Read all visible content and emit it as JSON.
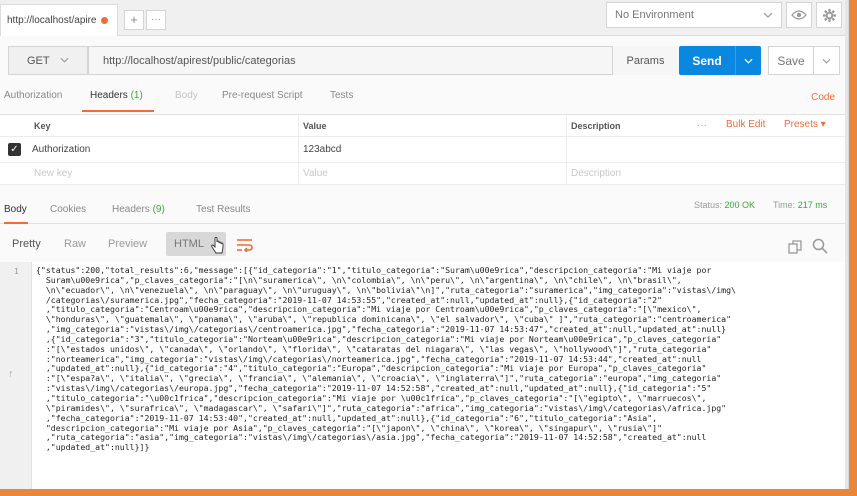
{
  "tabbar": {
    "tab_title": "http://localhost/apires",
    "add_label": "+",
    "more_label": "···",
    "environment": "No Environment"
  },
  "request": {
    "method": "GET",
    "url": "http://localhost/apirest/public/categorias",
    "params_label": "Params",
    "send_label": "Send",
    "save_label": "Save"
  },
  "request_tabs": {
    "authorization": "Authorization",
    "headers": "Headers",
    "headers_count": "(1)",
    "body": "Body",
    "pre_request": "Pre-request Script",
    "tests": "Tests",
    "code": "Code"
  },
  "headers_table": {
    "col_key": "Key",
    "col_value": "Value",
    "col_description": "Description",
    "more": "···",
    "bulk_edit": "Bulk Edit",
    "presets": "Presets ▾",
    "row_key": "Authorization",
    "row_value": "123abcd",
    "new_key_placeholder": "New key",
    "value_placeholder": "Value",
    "description_placeholder": "Description"
  },
  "response_tabs": {
    "body": "Body",
    "cookies": "Cookies",
    "headers": "Headers",
    "headers_count": "(9)",
    "test_results": "Test Results",
    "status_label": "Status:",
    "status_value": "200 OK",
    "time_label": "Time:",
    "time_value": "217 ms"
  },
  "response_toolbar": {
    "pretty": "Pretty",
    "raw": "Raw",
    "preview": "Preview",
    "html": "HTML"
  },
  "response_body": {
    "line_number": "1",
    "fold_marker": "f",
    "code": "{\"status\":200,\"total_results\":6,\"message\":[{\"id_categoria\":\"1\",\"titulo_categoria\":\"Suram\\u00e9rica\",\"descripcion_categoria\":\"Mi viaje por\n  Suram\\u00e9rica\",\"p_claves_categoria\":\"[\\n\\\"suramerica\\\", \\n\\\"colombia\\\", \\n\\\"peru\\\", \\n\\\"argentina\\\", \\n\\\"chile\\\", \\n\\\"brasil\\\",\n  \\n\\\"ecuador\\\", \\n\\\"venezuela\\\", \\n\\\"paraguay\\\", \\n\\\"uruguay\\\", \\n\\\"bolivia\\\"\\n]\",\"ruta_categoria\":\"suramerica\",\"img_categoria\":\"vistas\\/img\\\n  /categorias\\/suramerica.jpg\",\"fecha_categoria\":\"2019-11-07 14:53:55\",\"created_at\":null,\"updated_at\":null},{\"id_categoria\":\"2\"\n  ,\"titulo_categoria\":\"Centroam\\u00e9rica\",\"descripcion_categoria\":\"Mi viaje por Centroam\\u00e9rica\",\"p_claves_categoria\":\"[\\\"mexico\\\",\n  \\\"honduras\\\", \\\"guatemala\\\", \\\"panama\\\", \\\"aruba\\\", \\\"republica dominicana\\\", \\\"el salvador\\\", \\\"cuba\\\" ]\",\"ruta_categoria\":\"centroamerica\"\n  ,\"img_categoria\":\"vistas\\/img\\/categorias\\/centroamerica.jpg\",\"fecha_categoria\":\"2019-11-07 14:53:47\",\"created_at\":null,\"updated_at\":null}\n  ,{\"id_categoria\":\"3\",\"titulo_categoria\":\"Norteam\\u00e9rica\",\"descripcion_categoria\":\"Mi viaje por Norteam\\u00e9rica\",\"p_claves_categoria\"\n  :\"[\\\"estados unidos\\\", \\\"canada\\\", \\\"orlando\\\", \\\"florida\\\", \\\"cataratas del niagara\\\", \\\"las vegas\\\", \\\"hollywood\\\"]\",\"ruta_categoria\"\n  :\"norteamerica\",\"img_categoria\":\"vistas\\/img\\/categorias\\/norteamerica.jpg\",\"fecha_categoria\":\"2019-11-07 14:53:44\",\"created_at\":null\n  ,\"updated_at\":null},{\"id_categoria\":\"4\",\"titulo_categoria\":\"Europa\",\"descripcion_categoria\":\"Mi viaje por Europa\",\"p_claves_categoria\"\n  :\"[\\\"espa?a\\\", \\\"italia\\\", \\\"grecia\\\", \\\"francia\\\", \\\"alemania\\\", \\\"croacia\\\", \\\"inglaterra\\\"]\",\"ruta_categoria\":\"europa\",\"img_categoria\"\n  :\"vistas\\/img\\/categorias\\/europa.jpg\",\"fecha_categoria\":\"2019-11-07 14:52:58\",\"created_at\":null,\"updated_at\":null},{\"id_categoria\":\"5\"\n  ,\"titulo_categoria\":\"\\u00c1frica\",\"descripcion_categoria\":\"Mi viaje por \\u00c1frica\",\"p_claves_categoria\":\"[\\\"egipto\\\", \\\"marruecos\\\",\n  \\\"piramides\\\", \\\"surafrica\\\", \\\"madagascar\\\", \\\"safari\\\"]\",\"ruta_categoria\":\"africa\",\"img_categoria\":\"vistas\\/img\\/categorias\\/africa.jpg\"\n  ,\"fecha_categoria\":\"2019-11-07 14:53:40\",\"created_at\":null,\"updated_at\":null},{\"id_categoria\":\"6\",\"titulo_categoria\":\"Asia\",\n  \"descripcion_categoria\":\"Mi viaje por Asia\",\"p_claves_categoria\":\"[\\\"japon\\\", \\\"china\\\", \\\"korea\\\", \\\"singapur\\\", \\\"rusia\\\"]\"\n  ,\"ruta_categoria\":\"asia\",\"img_categoria\":\"vistas\\/img\\/categorias\\/asia.jpg\",\"fecha_categoria\":\"2019-11-07 14:52:58\",\"created_at\":null\n  ,\"updated_at\":null}]}"
  },
  "colors": {
    "accent": "#f26b3a",
    "send_button": "#0a88e0",
    "status_ok": "#3aaa35",
    "frame": "#e8863a"
  },
  "icons": [
    "chevron-down-icon",
    "eye-icon",
    "gear-icon",
    "checkbox-checked-icon",
    "wrap-lines-icon",
    "copy-icon",
    "search-icon",
    "hand-cursor-icon"
  ]
}
